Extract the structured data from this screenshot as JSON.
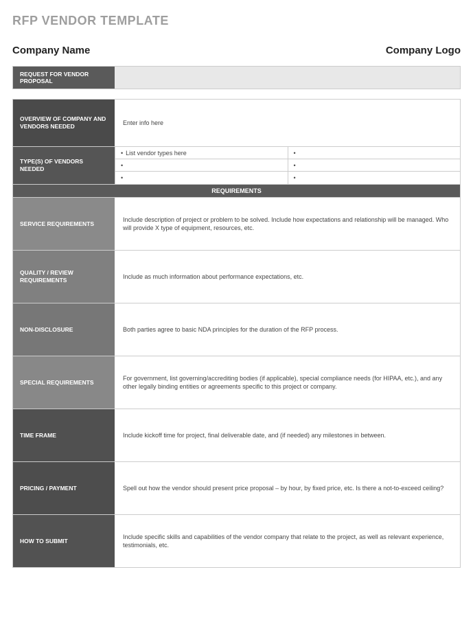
{
  "title": "RFP VENDOR TEMPLATE",
  "header": {
    "company_name": "Company Name",
    "company_logo": "Company Logo"
  },
  "proposal_bar": {
    "label": "REQUEST FOR VENDOR PROPOSAL"
  },
  "overview": {
    "label": "OVERVIEW OF COMPANY AND VENDORS NEEDED",
    "content": "Enter info here"
  },
  "vendor_types": {
    "label": "TYPE(S) OF VENDORS NEEDED",
    "cells": [
      "List vendor types here",
      "",
      "",
      "",
      "",
      ""
    ]
  },
  "requirements_header": "REQUIREMENTS",
  "rows": [
    {
      "label": "SERVICE REQUIREMENTS",
      "content": "Include description of project or problem to be solved. Include how expectations and relationship will be managed. Who will provide X type of equipment, resources, etc."
    },
    {
      "label": "QUALITY / REVIEW REQUIREMENTS",
      "content": "Include as much information about performance expectations, etc."
    },
    {
      "label": "NON-DISCLOSURE",
      "content": "Both parties agree to basic NDA principles for the duration of the RFP process."
    },
    {
      "label": "SPECIAL REQUIREMENTS",
      "content": "For government, list governing/accrediting bodies (if applicable), special compliance needs (for HIPAA, etc.), and any other legally binding entities or agreements specific to this project or company."
    },
    {
      "label": "TIME FRAME",
      "content": "Include kickoff time for project, final deliverable date, and (if needed) any milestones in between."
    },
    {
      "label": "PRICING / PAYMENT",
      "content": "Spell out how the vendor should present price proposal – by hour, by fixed price, etc. Is there a not-to-exceed ceiling?"
    },
    {
      "label": "HOW TO SUBMIT",
      "content": "Include specific skills and capabilities of the vendor company that relate to the project, as well as relevant experience, testimonials, etc."
    }
  ]
}
